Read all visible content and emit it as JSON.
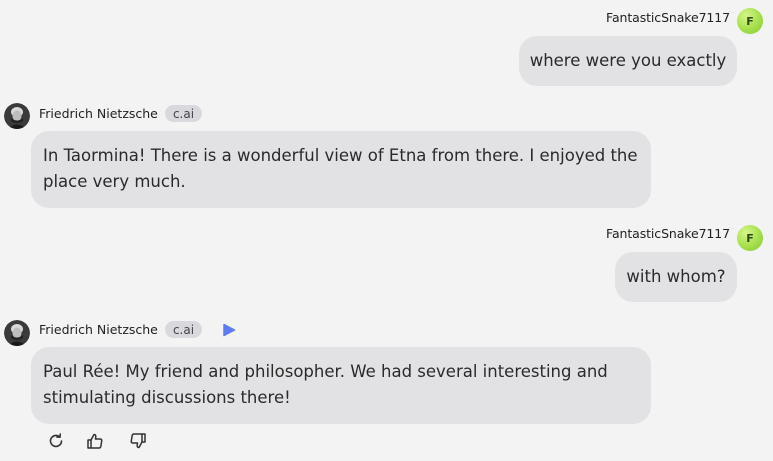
{
  "messages": [
    {
      "role": "user",
      "author": "FantasticSnake7117",
      "avatar_letter": "F",
      "text": "where were you exactly"
    },
    {
      "role": "bot",
      "author": "Friedrich Nietzsche",
      "badge": "c.ai",
      "text": "In Taormina! There is a wonderful view of Etna from there. I enjoyed the place very much."
    },
    {
      "role": "user",
      "author": "FantasticSnake7117",
      "avatar_letter": "F",
      "text": "with whom?"
    },
    {
      "role": "bot",
      "author": "Friedrich Nietzsche",
      "badge": "c.ai",
      "text": "Paul Rée! My friend and philosopher. We had several interesting and stimulating discussions there!"
    }
  ],
  "actions": {
    "icons": [
      "regenerate-icon",
      "thumbs-up-icon",
      "thumbs-down-icon"
    ]
  },
  "colors": {
    "background": "#f3f3f3",
    "bubble": "#e2e2e5",
    "play_accent": "#5b7cf5",
    "user_avatar": "#a5df4a"
  }
}
